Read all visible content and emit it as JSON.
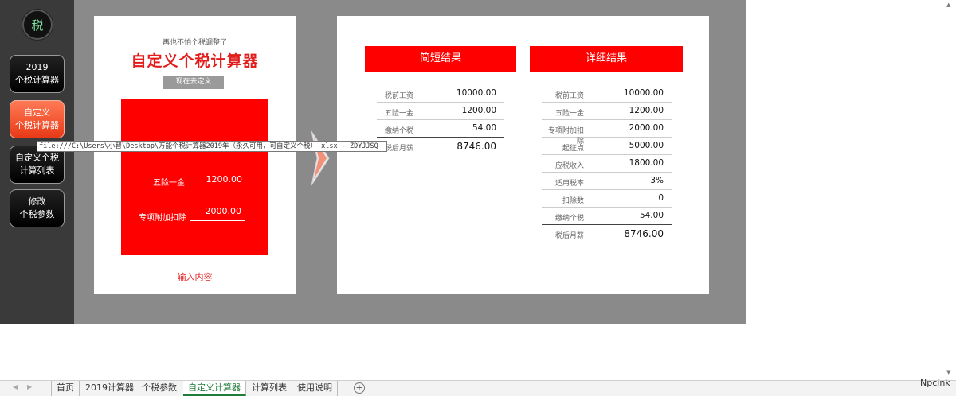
{
  "sidebar": {
    "logo": "税",
    "buttons": [
      {
        "line1": "2019",
        "line2": "个税计算器"
      },
      {
        "line1": "自定义",
        "line2": "个税计算器"
      },
      {
        "line1": "自定义个税",
        "line2": "计算列表"
      },
      {
        "line1": "修改",
        "line2": "个税参数"
      }
    ]
  },
  "input_card": {
    "subtitle": "再也不怕个税调整了",
    "title": "自定义个税计算器",
    "custom_button": "现在去定义",
    "fields": [
      {
        "label": "五险一金",
        "value": "1200.00"
      },
      {
        "label": "专项附加扣除",
        "value": "2000.00"
      }
    ],
    "footer": "输入内容"
  },
  "tooltip": "file:///C:\\Users\\小智\\Desktop\\万能个税计算器2019年（永久可用，可自定义个税）.xlsx - ZDYJJSQ",
  "results": {
    "brief": {
      "header": "简短结果",
      "rows": [
        {
          "label": "税前工资",
          "value": "10000.00"
        },
        {
          "label": "五险一金",
          "value": "1200.00"
        },
        {
          "label": "缴纳个税",
          "value": "54.00"
        },
        {
          "label": "税后月薪",
          "value": "8746.00"
        }
      ]
    },
    "detail": {
      "header": "详细结果",
      "rows": [
        {
          "label": "税前工资",
          "value": "10000.00"
        },
        {
          "label": "五险一金",
          "value": "1200.00"
        },
        {
          "label": "专项附加扣除",
          "value": "2000.00"
        },
        {
          "label": "起征点",
          "value": "5000.00"
        },
        {
          "label": "应税收入",
          "value": "1800.00"
        },
        {
          "label": "适用税率",
          "value": "3%"
        },
        {
          "label": "扣除数",
          "value": "0"
        },
        {
          "label": "缴纳个税",
          "value": "54.00"
        },
        {
          "label": "税后月薪",
          "value": "8746.00"
        }
      ]
    }
  },
  "tabs": [
    "首页",
    "2019计算器",
    "个税参数",
    "自定义计算器",
    "计算列表",
    "使用说明"
  ],
  "active_tab": "自定义计算器",
  "watermark": "Npcink",
  "colors": {
    "accent_red": "#ff0000",
    "active_tab": "#1e7b3a"
  }
}
